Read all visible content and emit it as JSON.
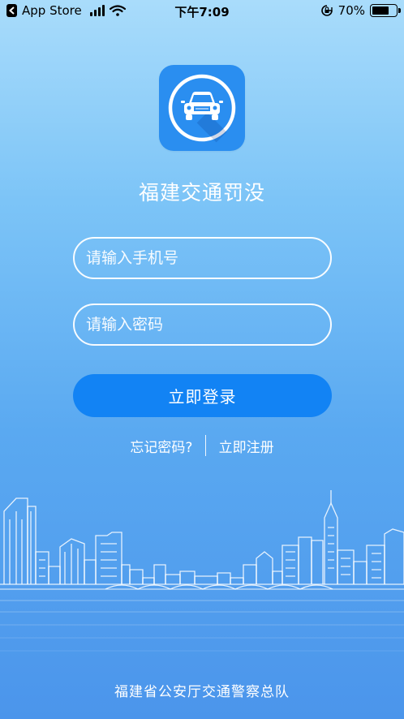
{
  "status_bar": {
    "back_app": "App Store",
    "time": "下午7:09",
    "battery": "70%",
    "battery_level": 0.7
  },
  "app": {
    "title": "福建交通罚没"
  },
  "form": {
    "phone_placeholder": "请输入手机号",
    "password_placeholder": "请输入密码",
    "login_label": "立即登录",
    "forgot_label": "忘记密码?",
    "register_label": "立即注册"
  },
  "footer": {
    "text": "福建省公安厅交通警察总队"
  },
  "icons": {
    "app_icon": "car-icon",
    "wifi": "wifi-icon",
    "battery": "battery-icon",
    "lock_rotation": "rotation-lock-icon",
    "back": "back-icon"
  },
  "colors": {
    "primary_button": "#1283f4",
    "icon_bg": "#2a8ef0"
  }
}
